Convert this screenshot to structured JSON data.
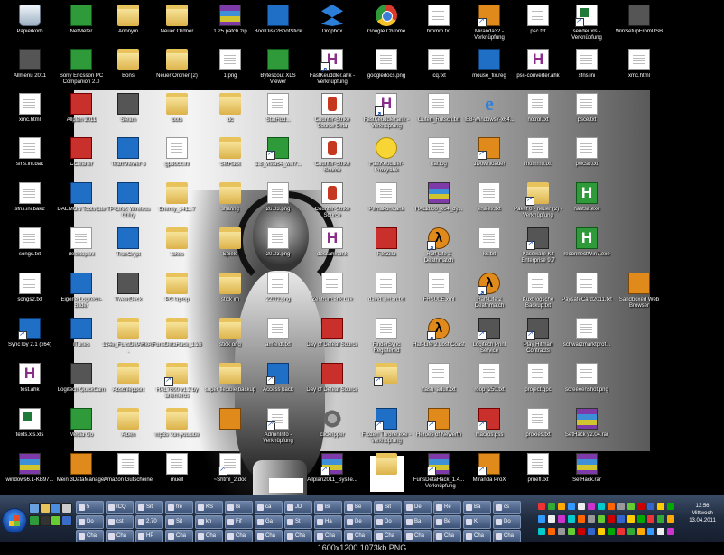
{
  "desktop": {
    "icons": [
      {
        "id": "papierkorb",
        "label": "Papierkorb",
        "icon": "recycle-bin-icon",
        "type": "trash"
      },
      {
        "id": "netmeter",
        "label": "NetMeter",
        "icon": "netmeter-icon",
        "type": "app-green"
      },
      {
        "id": "anonym",
        "label": "Anonym",
        "icon": "folder-icon",
        "type": "folder"
      },
      {
        "id": "neuer-ordner",
        "label": "Neuer Ordner",
        "icon": "folder-icon",
        "type": "folder"
      },
      {
        "id": "patch",
        "label": "1.25 patch.zip",
        "icon": "rar-icon",
        "type": "rar"
      },
      {
        "id": "bootdisk",
        "label": "BootDisk2BootStick",
        "icon": "floppy-icon",
        "type": "app-blue"
      },
      {
        "id": "dropbox",
        "label": "Dropbox",
        "icon": "dropbox-icon",
        "type": "drop"
      },
      {
        "id": "chrome",
        "label": "Google Chrome",
        "icon": "chrome-icon",
        "type": "chrome"
      },
      {
        "id": "hmmm",
        "label": "hmmm.txt",
        "icon": "text-file-icon",
        "type": "doc"
      },
      {
        "id": "miranda32",
        "label": "Miranda32 - Verknüpfung",
        "icon": "miranda-icon",
        "type": "app-orange"
      },
      {
        "id": "psc",
        "label": "psc.txt",
        "icon": "text-file-icon",
        "type": "doc"
      },
      {
        "id": "sender",
        "label": "sender.xls - Verknüpfung",
        "icon": "excel-icon",
        "type": "excel"
      },
      {
        "id": "winsetup",
        "label": "WinSetupFromUSB",
        "icon": "usb-icon",
        "type": "app-grey"
      },
      {
        "id": "allmenu",
        "label": "Allmenu 2011",
        "icon": "allmenu-icon",
        "type": "app-grey"
      },
      {
        "id": "sony",
        "label": "Sony Ericsson PC Companion 2.0",
        "icon": "sony-icon",
        "type": "app-green"
      },
      {
        "id": "bons",
        "label": "Bons",
        "icon": "folder-icon",
        "type": "folder"
      },
      {
        "id": "neuer-ordner-2",
        "label": "Neuer Ordner (2)",
        "icon": "folder-icon",
        "type": "folder"
      },
      {
        "id": "png1",
        "label": "1.png",
        "icon": "image-file-icon",
        "type": "doc"
      },
      {
        "id": "bytescout",
        "label": "Bytescout XLS Viewer",
        "icon": "xls-viewer-icon",
        "type": "app-green"
      },
      {
        "id": "fastkeuddler",
        "label": "FastKeuddler.ahk - Verknüpfung",
        "icon": "ahk-icon",
        "type": "h"
      },
      {
        "id": "googledocs",
        "label": "googledocs.png",
        "icon": "image-file-icon",
        "type": "doc"
      },
      {
        "id": "icq",
        "label": "icq.txt",
        "icon": "text-file-icon",
        "type": "doc"
      },
      {
        "id": "mousefix",
        "label": "mouse_fix.reg",
        "icon": "reg-icon",
        "type": "app-blue"
      },
      {
        "id": "pscconverter",
        "label": "psc-converter.ahk",
        "icon": "ahk-icon",
        "type": "h"
      },
      {
        "id": "sfns",
        "label": "sfns.ini",
        "icon": "ini-file-icon",
        "type": "doc"
      },
      {
        "id": "xmc",
        "label": "xmc.html",
        "icon": "html-file-icon",
        "type": "doc"
      },
      {
        "id": "allplan",
        "label": "Allplan 2011",
        "icon": "allplan-icon",
        "type": "app-red"
      },
      {
        "id": "steam",
        "label": "Steam",
        "icon": "steam-icon",
        "type": "app-grey"
      },
      {
        "id": "bots",
        "label": "bots",
        "icon": "folder-icon",
        "type": "folder"
      },
      {
        "id": "dc",
        "label": "dc",
        "icon": "folder-icon",
        "type": "folder"
      },
      {
        "id": "stathdd",
        "label": "StatHdd...",
        "icon": "word-icon",
        "type": "doc"
      },
      {
        "id": "gearbox",
        "label": "Counter-Strike Source Beta",
        "icon": "cs-icon",
        "type": "cs"
      },
      {
        "id": "fastkeuddler-pro",
        "label": "FastKeuddler.ahk - Verknüpfung",
        "icon": "ahk-icon",
        "type": "h"
      },
      {
        "id": "gutenfutsch",
        "label": "Guten_Rutsch.txt",
        "icon": "text-file-icon",
        "type": "doc"
      },
      {
        "id": "ie",
        "label": "IE8-Windows7-x64...",
        "icon": "ie-icon",
        "type": "ie"
      },
      {
        "id": "notrol",
        "label": "notrol.txt",
        "icon": "text-file-icon",
        "type": "doc"
      },
      {
        "id": "psce",
        "label": "psce.txt",
        "icon": "text-file-icon",
        "type": "doc"
      },
      {
        "id": "sfnsini",
        "label": "sfns.ini.bak",
        "icon": "ini-file-icon",
        "type": "doc"
      },
      {
        "id": "ccleaner",
        "label": "CCleaner",
        "icon": "ccleaner-icon",
        "type": "app-red"
      },
      {
        "id": "teamviewer",
        "label": "TeamViewer 6",
        "icon": "teamviewer-icon",
        "type": "app-blue"
      },
      {
        "id": "gpdock",
        "label": "gpdock.ini",
        "icon": "ini-file-icon",
        "type": "doc"
      },
      {
        "id": "sethack",
        "label": "SetHack",
        "icon": "folder-icon",
        "type": "folder"
      },
      {
        "id": "vista",
        "label": "1.8_vista64_win7...",
        "icon": "driver-icon",
        "type": "app-green"
      },
      {
        "id": "cstrike2",
        "label": "Counter-Strike Source",
        "icon": "cs-icon",
        "type": "cs"
      },
      {
        "id": "fastkeuddler-proxy",
        "label": "FastKeuddler-Proxy.ahk",
        "icon": "smiley-icon",
        "type": "smile"
      },
      {
        "id": "hallog",
        "label": "hal.log",
        "icon": "text-file-icon",
        "type": "doc"
      },
      {
        "id": "jdownloader",
        "label": "JDownloader",
        "icon": "jdownloader-icon",
        "type": "app-orange"
      },
      {
        "id": "mummu",
        "label": "mummu.txt",
        "icon": "text-file-icon",
        "type": "doc"
      },
      {
        "id": "pwcsb",
        "label": "pwcsb.txt",
        "icon": "text-file-icon",
        "type": "doc"
      },
      {
        "id": "sfnsbak2",
        "label": "sfns.ini.bak2",
        "icon": "ini-file-icon",
        "type": "doc"
      },
      {
        "id": "daemon",
        "label": "DAEMON Tools Lite",
        "icon": "daemon-icon",
        "type": "app-blue"
      },
      {
        "id": "tplink",
        "label": "TP-LINK Wireless Utility",
        "icon": "wireless-icon",
        "type": "app-blue"
      },
      {
        "id": "enemy",
        "label": "Enemy_1411.7",
        "icon": "folder-icon",
        "type": "folder"
      },
      {
        "id": "sharing",
        "label": "sharing",
        "icon": "folder-icon",
        "type": "folder"
      },
      {
        "id": "png2603",
        "label": "26.03.png",
        "icon": "image-file-icon",
        "type": "doc"
      },
      {
        "id": "cstrike3",
        "label": "Counter-Strike Source",
        "icon": "cs-icon",
        "type": "cs"
      },
      {
        "id": "pemakonv",
        "label": "Pemakonv.ahk",
        "icon": "text-file-icon",
        "type": "doc"
      },
      {
        "id": "hal2000",
        "label": "HAL2000_x64_dy...",
        "icon": "rar-icon",
        "type": "rar"
      },
      {
        "id": "knalex",
        "label": "knalex.txt",
        "icon": "text-file-icon",
        "type": "doc"
      },
      {
        "id": "paket",
        "label": "Paket 0 - neuer (2) - Verknüpfung",
        "icon": "folder-icon",
        "type": "folder"
      },
      {
        "id": "nastsa",
        "label": "nastsa.exe",
        "icon": "exe-icon",
        "type": "hg"
      },
      {
        "id": "songs",
        "label": "songs.txt",
        "icon": "text-file-icon",
        "type": "doc"
      },
      {
        "id": "desktopini",
        "label": "desktop.ini",
        "icon": "ini-file-icon",
        "type": "doc"
      },
      {
        "id": "truecrypt",
        "label": "TrueCrypt",
        "icon": "truecrypt-icon",
        "type": "app-blue"
      },
      {
        "id": "fakes",
        "label": "fakes",
        "icon": "folder-icon",
        "type": "folder"
      },
      {
        "id": "spiele",
        "label": "Spiele",
        "icon": "folder-icon",
        "type": "folder"
      },
      {
        "id": "png2003",
        "label": "20.03.png",
        "icon": "image-file-icon",
        "type": "doc"
      },
      {
        "id": "docsahk",
        "label": "docsahk.ahk",
        "icon": "ahk-icon",
        "type": "h"
      },
      {
        "id": "filezilla",
        "label": "FileZilla",
        "icon": "filezilla-icon",
        "type": "app-red"
      },
      {
        "id": "hl2",
        "label": "Half-Life 2 Deathmatch",
        "icon": "halflife-icon",
        "type": "hl"
      },
      {
        "id": "kslist",
        "label": "ks.txt",
        "icon": "text-file-icon",
        "type": "doc"
      },
      {
        "id": "passware",
        "label": "Passware Kit Enterprise 9.7",
        "icon": "passware-icon",
        "type": "app-grey"
      },
      {
        "id": "reconnect",
        "label": "reconnectWin7.exe",
        "icon": "exe-icon",
        "type": "hg"
      },
      {
        "id": "songs2",
        "label": "songs2.txt",
        "icon": "text-file-icon",
        "type": "doc"
      },
      {
        "id": "logitech",
        "label": "Eigene Logitech-Bilder",
        "icon": "logitech-icon",
        "type": "app-blue"
      },
      {
        "id": "tweetdeck",
        "label": "TweetDeck",
        "icon": "tweetdeck-icon",
        "type": "app-grey"
      },
      {
        "id": "pclaptop",
        "label": "PC laptop",
        "icon": "folder-icon",
        "type": "folder"
      },
      {
        "id": "stickim",
        "label": "stick im",
        "icon": "folder-icon",
        "type": "folder"
      },
      {
        "id": "png2202",
        "label": "22.02.png",
        "icon": "image-file-icon",
        "type": "doc"
      },
      {
        "id": "zentrum",
        "label": "Zentrum.ahk.bak",
        "icon": "text-file-icon",
        "type": "doc"
      },
      {
        "id": "davidlipman",
        "label": "davidlipman.txt",
        "icon": "text-file-icon",
        "type": "doc"
      },
      {
        "id": "fhsulexml",
        "label": "FHSULE.xml",
        "icon": "text-file-icon",
        "type": "doc"
      },
      {
        "id": "hl2b",
        "label": "Half-Life 2 Deathmatch",
        "icon": "halflife-icon",
        "type": "hl"
      },
      {
        "id": "kuxblog",
        "label": "Kuxblogsche Backup.txt",
        "icon": "text-file-icon",
        "type": "doc"
      },
      {
        "id": "paysafe",
        "label": "PaysafeCard2011.txt",
        "icon": "text-file-icon",
        "type": "doc"
      },
      {
        "id": "sandboxed",
        "label": "Sandboxed Web Browser",
        "icon": "sandbox-icon",
        "type": "app-orange"
      },
      {
        "id": "synctoy",
        "label": "SyncToy 2.1 (x64)",
        "icon": "synctoy-icon",
        "type": "app-blue"
      },
      {
        "id": "itunes",
        "label": "iTunes",
        "icon": "itunes-icon",
        "type": "app-blue"
      },
      {
        "id": "124e",
        "label": "124e_FunsDelAHkA...",
        "icon": "folder-icon",
        "type": "folder"
      },
      {
        "id": "funsdeta",
        "label": "FunsDetaHack_1.26",
        "icon": "folder-icon",
        "type": "folder"
      },
      {
        "id": "stickorig",
        "label": "stick orig",
        "icon": "folder-icon",
        "type": "folder"
      },
      {
        "id": "amfeldt",
        "label": "amfeldt.txt",
        "icon": "text-file-icon",
        "type": "doc"
      },
      {
        "id": "dods",
        "label": "Day of Defeat Source",
        "icon": "dod-icon",
        "type": "app-red"
      },
      {
        "id": "findersync",
        "label": "FinderSync Registered",
        "icon": "text-file-icon",
        "type": "doc"
      },
      {
        "id": "hl2lost",
        "label": "Half-Life 2 Lost Coast",
        "icon": "halflife-icon",
        "type": "hl"
      },
      {
        "id": "logitechprint",
        "label": "Logitech Print Service",
        "icon": "printer-icon",
        "type": "app-grey"
      },
      {
        "id": "playhitman",
        "label": "Play Hitman Contracts",
        "icon": "hitman-icon",
        "type": "app-grey"
      },
      {
        "id": "schwarzmarkt",
        "label": "schwarzmarktprof...",
        "icon": "text-file-icon",
        "type": "doc"
      },
      {
        "id": "testahk",
        "label": "test.ahk",
        "icon": "ahk-icon",
        "type": "h"
      },
      {
        "id": "quickcam",
        "label": "Logitech QuickCam",
        "icon": "webcam-icon",
        "type": "app-grey"
      },
      {
        "id": "abschlepp",
        "label": "Abschlepport",
        "icon": "folder-icon",
        "type": "folder"
      },
      {
        "id": "hal7600",
        "label": "HAL7600 v1.2 by anemeros",
        "icon": "folder-icon",
        "type": "folder"
      },
      {
        "id": "superflexible",
        "label": "super flexible backup",
        "icon": "folder-icon",
        "type": "folder"
      },
      {
        "id": "accessback",
        "label": "Access back",
        "icon": "windows-icon",
        "type": "app-blue"
      },
      {
        "id": "dods2",
        "label": "Day of Defeat Source",
        "icon": "dod-icon",
        "type": "app-red"
      },
      {
        "id": "winfolder",
        "label": "",
        "icon": "folder-icon",
        "type": "folder"
      },
      {
        "id": "hashadult",
        "label": "hash_adult.txt",
        "icon": "text-file-icon",
        "type": "doc"
      },
      {
        "id": "roop",
        "label": "roop_250.txt",
        "icon": "text-file-icon",
        "type": "doc"
      },
      {
        "id": "projectgpc",
        "label": "project.gpc",
        "icon": "text-file-icon",
        "type": "doc"
      },
      {
        "id": "screeen",
        "label": "screeeenshot.png",
        "icon": "image-file-icon",
        "type": "doc"
      },
      {
        "id": "textsxls",
        "label": "texts.xls.xls",
        "icon": "excel-icon",
        "type": "excel"
      },
      {
        "id": "mediago",
        "label": "Media Go",
        "icon": "mediago-icon",
        "type": "app-green"
      },
      {
        "id": "alben",
        "label": "Alben",
        "icon": "folder-icon",
        "type": "folder"
      },
      {
        "id": "mp3",
        "label": "mp3s von youtube",
        "icon": "folder-icon",
        "type": "folder"
      },
      {
        "id": "wfolder2",
        "label": "",
        "icon": "folder-icon",
        "type": "app-orange"
      },
      {
        "id": "adminfo",
        "label": "AdminInfo - Verknüpfung",
        "icon": "text-file-icon",
        "type": "doc"
      },
      {
        "id": "clickripper",
        "label": "clickripper",
        "icon": "gear-icon",
        "type": "gear"
      },
      {
        "id": "frozenthrone",
        "label": "Frozen Throne.exe - Verknüpfung",
        "icon": "warcraft-icon",
        "type": "app-blue"
      },
      {
        "id": "heroes",
        "label": "Heroes of Newerth",
        "icon": "hon-icon",
        "type": "app-orange"
      },
      {
        "id": "macrospss",
        "label": "macros.pss",
        "icon": "sum-icon",
        "type": "app-red"
      },
      {
        "id": "proxies",
        "label": "proxies.txt",
        "icon": "text-file-icon",
        "type": "doc"
      },
      {
        "id": "sethack24",
        "label": "SetHack v2.04.rar",
        "icon": "rar-icon",
        "type": "rar"
      },
      {
        "id": "windows61",
        "label": "windows6.1-KB97...",
        "icon": "rar-icon",
        "type": "rar"
      },
      {
        "id": "3data",
        "label": "Mein 3DataManager",
        "icon": "3data-icon",
        "type": "app-orange"
      },
      {
        "id": "amazon",
        "label": "Amazon Gutscheine",
        "icon": "text-file-icon",
        "type": "doc"
      },
      {
        "id": "muell",
        "label": "muell",
        "icon": "text-file-icon",
        "type": "doc"
      },
      {
        "id": "shtml",
        "label": "~Shtml_2.doc",
        "icon": "text-file-icon",
        "type": "doc"
      },
      {
        "id": "allplansys",
        "label": "Allplan2011_SysTe...",
        "icon": "rar-icon",
        "type": "rar"
      },
      {
        "id": "folderfuns",
        "label": "",
        "icon": "folder-icon",
        "type": "folder"
      },
      {
        "id": "funsdeta14",
        "label": "FunsDetaHack_1.4... - Verknüpfung",
        "icon": "rar-icon",
        "type": "rar"
      },
      {
        "id": "mirandapro",
        "label": "Miranda ProX",
        "icon": "miranda-icon",
        "type": "app-orange"
      },
      {
        "id": "pruefl",
        "label": "pruefl.txt",
        "icon": "text-file-icon",
        "type": "doc"
      },
      {
        "id": "sethackrar",
        "label": "SetHack.rar",
        "icon": "rar-icon",
        "type": "rar"
      },
      {
        "id": "windows7",
        "label": "windows7manage...",
        "icon": "rar-icon",
        "type": "rar"
      }
    ]
  },
  "taskbar": {
    "buttons": [
      {
        "label": "5"
      },
      {
        "label": "ICQ"
      },
      {
        "label": "Sit"
      },
      {
        "label": "fre"
      },
      {
        "label": "KS"
      },
      {
        "label": "Bi"
      },
      {
        "label": "ca"
      },
      {
        "label": "JD"
      },
      {
        "label": "Bi"
      },
      {
        "label": "Be"
      },
      {
        "label": "Sit"
      },
      {
        "label": "De"
      },
      {
        "label": "Re"
      },
      {
        "label": "Ba"
      },
      {
        "label": "cs"
      },
      {
        "label": "Do"
      },
      {
        "label": "cst"
      },
      {
        "label": "2.70"
      },
      {
        "label": "Sit"
      },
      {
        "label": "kn"
      },
      {
        "label": "Fif"
      },
      {
        "label": "Ga"
      },
      {
        "label": "St"
      },
      {
        "label": "Ha"
      },
      {
        "label": "De"
      },
      {
        "label": "Do"
      },
      {
        "label": "Ba"
      },
      {
        "label": "Be"
      },
      {
        "label": "Ki"
      },
      {
        "label": "Do"
      },
      {
        "label": "Cha"
      },
      {
        "label": "Cha"
      },
      {
        "label": "HP"
      },
      {
        "label": "Cha"
      },
      {
        "label": "Cha"
      },
      {
        "label": "Cha"
      },
      {
        "label": "Cha"
      },
      {
        "label": "Cha"
      },
      {
        "label": "Cha"
      },
      {
        "label": "Cha"
      },
      {
        "label": "Cha"
      },
      {
        "label": "Cha"
      },
      {
        "label": "Cha"
      },
      {
        "label": "Cha"
      },
      {
        "label": "Cha"
      }
    ],
    "clock": {
      "time": "13:56",
      "day": "Mittwoch",
      "date": "13.04.2011"
    }
  },
  "caption": "1600x1200  1073kb  PNG"
}
